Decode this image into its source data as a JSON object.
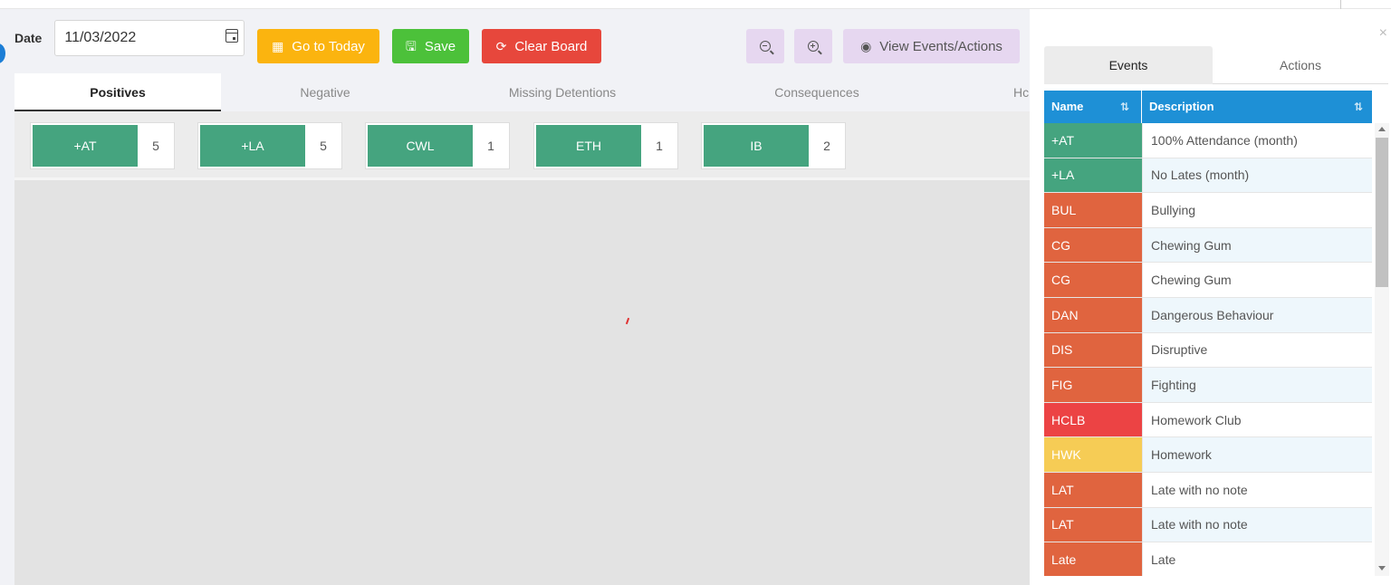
{
  "toolbar": {
    "date_label": "Date",
    "date_value": "11/03/2022",
    "go_today_label": "Go to Today",
    "save_label": "Save",
    "clear_label": "Clear Board",
    "view_label": "View Events/Actions"
  },
  "tabs": [
    {
      "label": "Positives",
      "active": true
    },
    {
      "label": "Negative",
      "active": false
    },
    {
      "label": "Missing Detentions",
      "active": false
    },
    {
      "label": "Consequences",
      "active": false
    },
    {
      "label": "Hc",
      "active": false
    }
  ],
  "board": {
    "cards": [
      {
        "code": "+AT",
        "count": "5"
      },
      {
        "code": "+LA",
        "count": "5"
      },
      {
        "code": "CWL",
        "count": "1"
      },
      {
        "code": "ETH",
        "count": "1"
      },
      {
        "code": "IB",
        "count": "2"
      }
    ]
  },
  "panel": {
    "close": "×",
    "tabs": [
      {
        "label": "Events",
        "active": true
      },
      {
        "label": "Actions",
        "active": false
      }
    ],
    "columns": {
      "name": "Name",
      "description": "Description"
    },
    "rows": [
      {
        "name": "+AT",
        "description": "100% Attendance (month)",
        "color": "#45a47f"
      },
      {
        "name": "+LA",
        "description": "No Lates (month)",
        "color": "#45a47f"
      },
      {
        "name": "BUL",
        "description": "Bullying",
        "color": "#e0643f"
      },
      {
        "name": "CG",
        "description": "Chewing Gum",
        "color": "#e0643f"
      },
      {
        "name": "CG",
        "description": "Chewing Gum",
        "color": "#e0643f"
      },
      {
        "name": "DAN",
        "description": "Dangerous Behaviour",
        "color": "#e0643f"
      },
      {
        "name": "DIS",
        "description": "Disruptive",
        "color": "#e0643f"
      },
      {
        "name": "FIG",
        "description": "Fighting",
        "color": "#e0643f"
      },
      {
        "name": "HCLB",
        "description": "Homework Club",
        "color": "#ec4344"
      },
      {
        "name": "HWK",
        "description": "Homework",
        "color": "#f6cc55"
      },
      {
        "name": "LAT",
        "description": "Late with no note",
        "color": "#e0643f"
      },
      {
        "name": "LAT",
        "description": "Late with no note",
        "color": "#e0643f"
      },
      {
        "name": "Late",
        "description": "Late",
        "color": "#e0643f"
      }
    ]
  }
}
